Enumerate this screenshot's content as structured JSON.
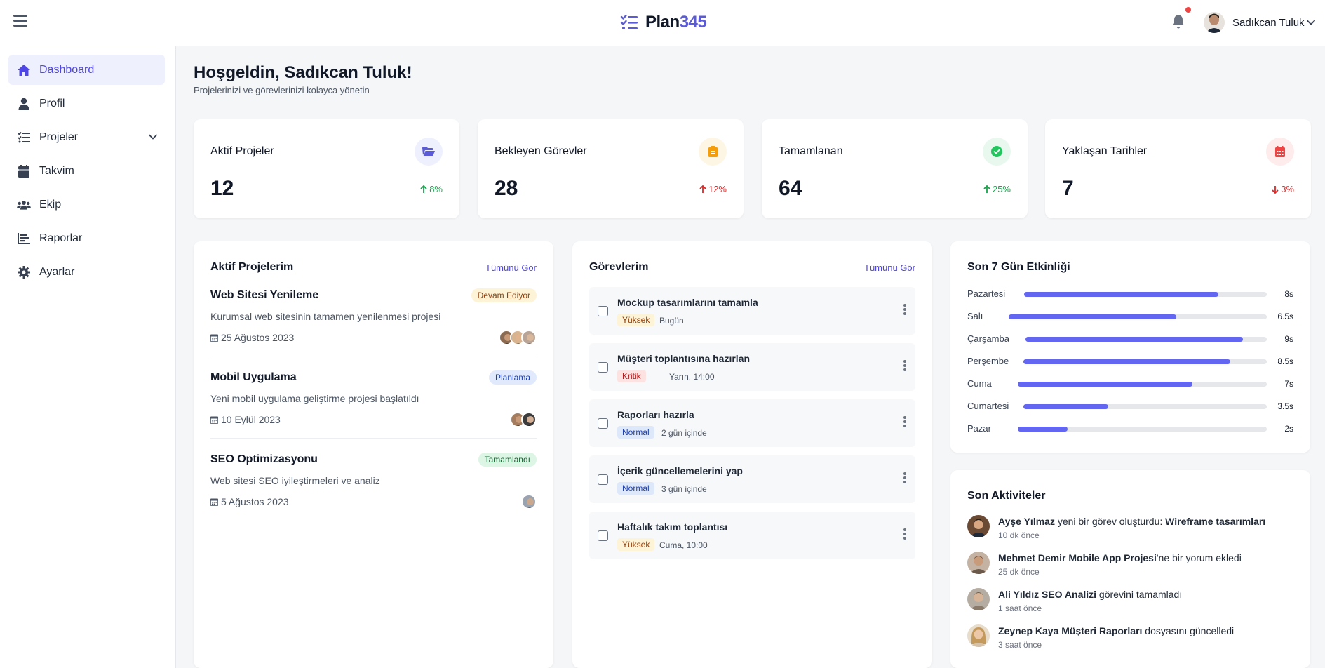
{
  "header": {
    "brand_name": "Plan",
    "brand_number": "345",
    "user_name": "Sadıkcan Tuluk"
  },
  "sidebar": {
    "items": [
      {
        "label": "Dashboard",
        "icon": "home-icon"
      },
      {
        "label": "Profil",
        "icon": "user-icon"
      },
      {
        "label": "Projeler",
        "icon": "list-check-icon"
      },
      {
        "label": "Takvim",
        "icon": "calendar-icon"
      },
      {
        "label": "Ekip",
        "icon": "users-icon"
      },
      {
        "label": "Raporlar",
        "icon": "chart-bar-icon"
      },
      {
        "label": "Ayarlar",
        "icon": "gear-icon"
      }
    ]
  },
  "welcome": {
    "title": "Hoşgeldin, Sadıkcan Tuluk!",
    "subtitle": "Projelerinizi ve görevlerinizi kolayca yönetin"
  },
  "stats": [
    {
      "title": "Aktif Projeler",
      "value": "12",
      "trend": "8%",
      "direction": "up",
      "trend_color": "#16a34a",
      "icon": "folder-open-icon",
      "accent": "#5b5bd6",
      "accent_bg": "#eef0fd"
    },
    {
      "title": "Bekleyen Görevler",
      "value": "28",
      "trend": "12%",
      "direction": "up",
      "trend_color": "#dc2626",
      "icon": "clipboard-icon",
      "accent": "#f59e0b",
      "accent_bg": "#fef6e4"
    },
    {
      "title": "Tamamlanan",
      "value": "64",
      "trend": "25%",
      "direction": "up",
      "trend_color": "#16a34a",
      "icon": "check-circle-icon",
      "accent": "#22c55e",
      "accent_bg": "#e8f8ee"
    },
    {
      "title": "Yaklaşan Tarihler",
      "value": "7",
      "trend": "3%",
      "direction": "down",
      "trend_color": "#dc2626",
      "icon": "calendar-icon",
      "accent": "#ef4444",
      "accent_bg": "#fdeceb"
    }
  ],
  "projects": {
    "title": "Aktif Projelerim",
    "link": "Tümünü Gör",
    "items": [
      {
        "name": "Web Sitesi Yenileme",
        "status": "Devam Ediyor",
        "status_bg": "#fdf3d7",
        "status_color": "#92400e",
        "description": "Kurumsal web sitesinin tamamen yenilenmesi projesi",
        "date": "25 Ağustos 2023",
        "avatars": 3
      },
      {
        "name": "Mobil Uygulama",
        "status": "Planlama",
        "status_bg": "#e0eafc",
        "status_color": "#1e40af",
        "description": "Yeni mobil uygulama geliştirme projesi başlatıldı",
        "date": "10 Eylül 2023",
        "avatars": 2
      },
      {
        "name": "SEO Optimizasyonu",
        "status": "Tamamlandı",
        "status_bg": "#dcf5e4",
        "status_color": "#166534",
        "description": "Web sitesi SEO iyileştirmeleri ve analiz",
        "date": "5 Ağustos 2023",
        "avatars": 1
      }
    ]
  },
  "tasks": {
    "title": "Görevlerim",
    "link": "Tümünü Gör",
    "items": [
      {
        "name": "Mockup tasarımlarını tamamla",
        "priority": "Yüksek",
        "priority_bg": "#fdf3d7",
        "priority_color": "#92400e",
        "due": "Bugün"
      },
      {
        "name": "Müşteri toplantısına hazırlan",
        "priority": "Kritik",
        "priority_bg": "#fde2e2",
        "priority_color": "#b91c1c",
        "due": "Yarın, 14:00"
      },
      {
        "name": "Raporları hazırla",
        "priority": "Normal",
        "priority_bg": "#dde8fb",
        "priority_color": "#1e40af",
        "due": "2 gün içinde"
      },
      {
        "name": "İçerik güncellemelerini yap",
        "priority": "Normal",
        "priority_bg": "#dde8fb",
        "priority_color": "#1e40af",
        "due": "3 gün içinde"
      },
      {
        "name": "Haftalık takım toplantısı",
        "priority": "Yüksek",
        "priority_bg": "#fdf3d7",
        "priority_color": "#92400e",
        "due": "Cuma, 10:00"
      }
    ]
  },
  "activity": {
    "title": "Son 7 Gün Etkinliği",
    "max": 10,
    "days": [
      {
        "day": "Pazartesi",
        "value": 8,
        "label": "8s"
      },
      {
        "day": "Salı",
        "value": 6.5,
        "label": "6.5s"
      },
      {
        "day": "Çarşamba",
        "value": 9,
        "label": "9s"
      },
      {
        "day": "Perşembe",
        "value": 8.5,
        "label": "8.5s"
      },
      {
        "day": "Cuma",
        "value": 7,
        "label": "7s"
      },
      {
        "day": "Cumartesi",
        "value": 3.5,
        "label": "3.5s"
      },
      {
        "day": "Pazar",
        "value": 2,
        "label": "2s"
      }
    ]
  },
  "recent": {
    "title": "Son Aktiviteler",
    "items": [
      {
        "actor": "Ayşe Yılmaz",
        "pre": " yeni bir görev oluşturdu: ",
        "target": "Wireframe tasarımları",
        "post": "",
        "time": "10 dk önce"
      },
      {
        "actor": "Mehmet Demir",
        "pre": " ",
        "target": "Mobile App Projesi",
        "post": "'ne bir yorum ekledi",
        "time": "25 dk önce"
      },
      {
        "actor": "Ali Yıldız",
        "pre": " ",
        "target": "SEO Analizi",
        "post": " görevini tamamladı",
        "time": "1 saat önce"
      },
      {
        "actor": "Zeynep Kaya",
        "pre": " ",
        "target": "Müşteri Raporları",
        "post": " dosyasını güncelledi",
        "time": "3 saat önce"
      }
    ]
  }
}
